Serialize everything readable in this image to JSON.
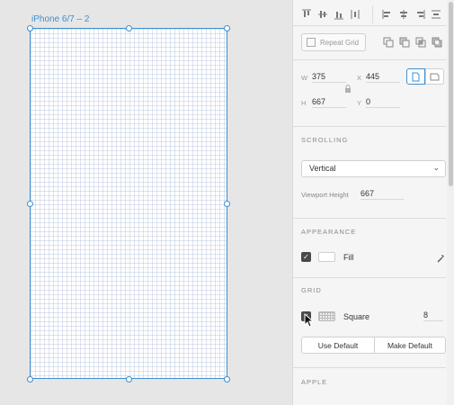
{
  "canvas": {
    "artboard_title": "iPhone 6/7 – 2",
    "accent_color": "#3d8fd1"
  },
  "inspector": {
    "toolbar": {
      "icons": [
        "align-top-icon",
        "align-middle-icon",
        "align-bottom-icon",
        "distribute-vertical-icon",
        "align-left-icon",
        "align-center-icon",
        "align-right-icon",
        "distribute-horizontal-icon"
      ]
    },
    "repeat_grid": {
      "label": "Repeat Grid"
    },
    "boolean_icons": [
      "add-icon",
      "subtract-icon",
      "intersect-icon",
      "exclude-icon"
    ],
    "transform": {
      "w_label": "W",
      "w_value": "375",
      "x_label": "X",
      "x_value": "445",
      "h_label": "H",
      "h_value": "667",
      "y_label": "Y",
      "y_value": "0"
    },
    "scrolling": {
      "title": "SCROLLING",
      "selected": "Vertical",
      "viewport_label": "Viewport Height",
      "viewport_value": "667"
    },
    "appearance": {
      "title": "APPEARANCE",
      "fill_label": "Fill",
      "fill_checked": true,
      "fill_color": "#ffffff"
    },
    "grid": {
      "title": "GRID",
      "type": "Square",
      "size": "8",
      "checked": true,
      "use_default": "Use Default",
      "make_default": "Make Default"
    },
    "apple": {
      "title": "APPLE"
    }
  }
}
